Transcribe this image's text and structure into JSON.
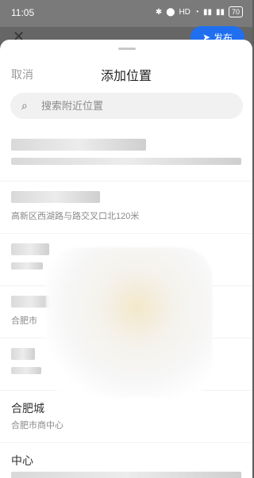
{
  "status": {
    "time": "11:05",
    "battery": "70"
  },
  "background": {
    "publish": "发布"
  },
  "sheet": {
    "cancel": "取消",
    "title": "添加位置"
  },
  "search": {
    "placeholder": "搜索附近位置"
  },
  "items": [
    {
      "name": "",
      "addr": ""
    },
    {
      "name": "",
      "addr": "高新区西湖路与路交叉口北120米"
    },
    {
      "name": "",
      "addr": ""
    },
    {
      "name": "",
      "addr": "合肥市"
    },
    {
      "name": "",
      "addr": ""
    },
    {
      "name": "合肥城",
      "addr": "合肥市商中心"
    },
    {
      "name": "中心",
      "addr": ""
    }
  ]
}
